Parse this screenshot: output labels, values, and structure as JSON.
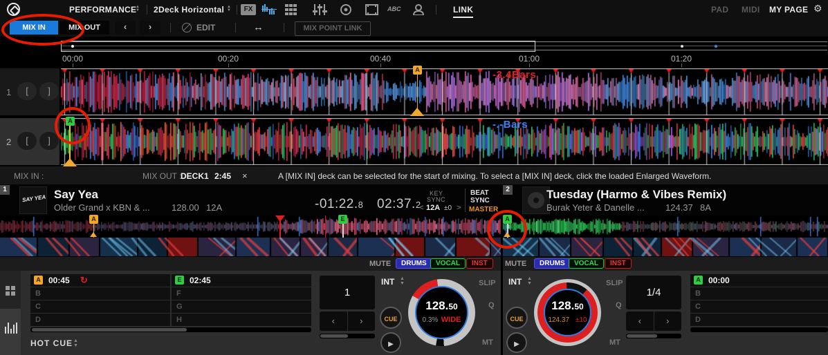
{
  "toolbar": {
    "mode_label": "PERFORMANCE",
    "layout_label": "2Deck Horizontal",
    "fx_label": "FX",
    "abc_label": "ABC",
    "link_label": "LINK",
    "pad_label": "PAD",
    "midi_label": "MIDI",
    "my_page_label": "MY PAGE"
  },
  "mixbar": {
    "mix_in": "MIX IN",
    "mix_out": "MIX OUT",
    "edit": "EDIT",
    "mix_point_link": "MIX POINT LINK"
  },
  "icons": {
    "prev": "‹",
    "next": "›",
    "close": "×",
    "loop": "↺",
    "play": "▶",
    "resize": "↔",
    "gear": "⚙",
    "chevron_up": "▲",
    "chevron_down": "▼",
    "key_prev": "<",
    "key_next": ">"
  },
  "timeline": {
    "t0": "00:00",
    "t1": "00:20",
    "t2": "00:40",
    "t3": "01:00",
    "t4": "01:20"
  },
  "gutter": {
    "deck1_num": "1",
    "deck2_num": "2",
    "bracket_open": "[",
    "bracket_close": "]"
  },
  "enlarged": {
    "deck1_bars": "-3.4Bars",
    "deck2_bars": "-.-Bars",
    "deck1_cue": "A",
    "deck2_cue": "A"
  },
  "status": {
    "mix_in_label": "MIX IN :",
    "mix_out_label": "MIX OUT :",
    "deck": "DECK1",
    "time": "2:45",
    "message": "A [MIX IN] deck can be selected for the start of mixing. To select a [MIX IN] deck, click the loaded Enlarged Waveform."
  },
  "deck1": {
    "num": "1",
    "art_text": "SAY YEA",
    "title": "Say Yea",
    "artist": "Older Grand x KBN & ...",
    "bpm": "128.00",
    "key": "12A",
    "remain": "-01:22.",
    "remain_f": "8",
    "elapsed": "02:37.",
    "elapsed_f": "2",
    "key_sync_l1": "KEY",
    "key_sync_l2": "SYNC",
    "key_val": "12A",
    "key_off": "±0",
    "beat_sync_l1": "BEAT",
    "beat_sync_l2": "SYNC",
    "master": "MASTER",
    "mute": "MUTE",
    "stem_drums": "DRUMS",
    "stem_vocal": "VOCAL",
    "stem_inst": "INST",
    "cueA_letter": "A",
    "cueA_time": "00:45",
    "cueB": "B",
    "cueC": "C",
    "cueD": "D",
    "cueE_letter": "E",
    "cueE_time": "02:45",
    "cueF": "F",
    "cueG": "G",
    "cueH": "H",
    "beatjump": "1",
    "int": "INT",
    "cue": "CUE",
    "bpm_main": "128.",
    "bpm_frac": "50",
    "sub_left": "0.3%",
    "sub_right": "WIDE",
    "slip": "SLIP",
    "q": "Q",
    "mt": "MT",
    "hot_cue": "HOT CUE"
  },
  "deck2": {
    "num": "2",
    "title": "Tuesday (Harmo & Vibes Remix)",
    "artist": "Burak Yeter & Danelle ...",
    "bpm": "124.37",
    "key": "8A",
    "mute": "MUTE",
    "stem_drums": "DRUMS",
    "stem_vocal": "VOCAL",
    "stem_inst": "INST",
    "cueA_letter": "A",
    "cueA_time": "00:00",
    "cueB": "B",
    "cueC": "C",
    "cueD": "D",
    "beatjump": "1/4",
    "int": "INT",
    "cue": "CUE",
    "bpm_main": "128.",
    "bpm_frac": "50",
    "sub_left": "124.37",
    "sub_right": "±10",
    "slip": "SLIP",
    "q": "Q",
    "mt": "MT"
  },
  "strip_markers": {
    "deck1_a": "A",
    "deck1_e": "E",
    "deck2_a": "A"
  },
  "colors": {
    "accent_blue": "#1a7ad9",
    "master_orange": "#e8941a",
    "cue_orange": "#f5a623",
    "cue_green": "#2ecc40",
    "alert_red": "#e02020",
    "bars_blue": "#3b82f6",
    "annotation_red": "#e81c00"
  }
}
